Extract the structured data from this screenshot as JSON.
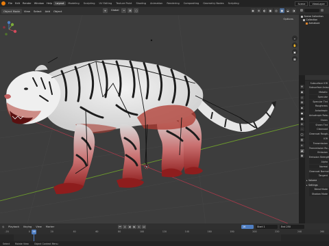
{
  "topbar": {
    "menus": [
      "File",
      "Edit",
      "Render",
      "Window",
      "Help"
    ],
    "tabs": [
      "Layout",
      "Modeling",
      "Sculpting",
      "UV Editing",
      "Texture Paint",
      "Shading",
      "Animation",
      "Rendering",
      "Compositing",
      "Geometry Nodes",
      "Scripting"
    ],
    "active_tab": "Layout",
    "scene_label": "Scene",
    "view_layer_label": "ViewLayer"
  },
  "viewport_header": {
    "mode": "Object Mode",
    "menus": [
      "View",
      "Select",
      "Add",
      "Object"
    ],
    "transform": "Global",
    "options": "Options"
  },
  "outliner": {
    "rows": [
      {
        "label": "Scene Collection",
        "indent": 0,
        "icon": "collection-icon"
      },
      {
        "label": "Collection",
        "indent": 1,
        "icon": "collection-icon"
      },
      {
        "label": "Armature",
        "indent": 2,
        "icon": "armature-icon"
      }
    ]
  },
  "properties": {
    "rows": [
      {
        "label": "Subsurface IOR",
        "kind": "field"
      },
      {
        "label": "Subsurface Aniso...",
        "kind": "field"
      },
      {
        "label": "Metallic",
        "kind": "field"
      },
      {
        "label": "Specular",
        "kind": "field"
      },
      {
        "label": "Specular Tint",
        "kind": "field"
      },
      {
        "label": "Roughness",
        "kind": "field"
      },
      {
        "label": "Anisotropic",
        "kind": "field"
      },
      {
        "label": "Anisotropic Rota...",
        "kind": "field"
      },
      {
        "label": "Sheen",
        "kind": "field"
      },
      {
        "label": "Sheen Tint",
        "kind": "field"
      },
      {
        "label": "Clearcoat",
        "kind": "field"
      },
      {
        "label": "Clearcoat Rough...",
        "kind": "field"
      },
      {
        "label": "IOR",
        "kind": "field"
      },
      {
        "label": "Transmission",
        "kind": "field"
      },
      {
        "label": "Transmission Ro...",
        "kind": "field"
      },
      {
        "label": "Emission",
        "kind": "field"
      },
      {
        "label": "Emission Strength",
        "kind": "field"
      },
      {
        "label": "Alpha",
        "kind": "field"
      },
      {
        "label": "Normal",
        "kind": "field"
      },
      {
        "label": "Clearcoat Normal",
        "kind": "field"
      },
      {
        "label": "Tangent",
        "kind": "field"
      },
      {
        "label": "Volume",
        "kind": "section"
      },
      {
        "label": "Settings",
        "kind": "section"
      },
      {
        "label": "Blend Mode",
        "kind": "field"
      },
      {
        "label": "Shadow Mode",
        "kind": "field"
      }
    ]
  },
  "timeline": {
    "menus": [
      "Playback",
      "Keying",
      "View",
      "Marker"
    ],
    "current_frame": "16",
    "start": "Start 1",
    "end": "End 250",
    "ticks": [
      "-20",
      "0",
      "20",
      "40",
      "60",
      "80",
      "100",
      "120",
      "140",
      "160",
      "180",
      "200",
      "220",
      "240",
      "260"
    ]
  },
  "status_bar": {
    "items": [
      "Select",
      "Rotate View",
      "Object Context Menu"
    ]
  },
  "colors": {
    "accent": "#4f7ec2",
    "blender_orange": "#e87d0d",
    "x_axis": "#a43a4a",
    "y_axis": "#6d9b2d"
  }
}
